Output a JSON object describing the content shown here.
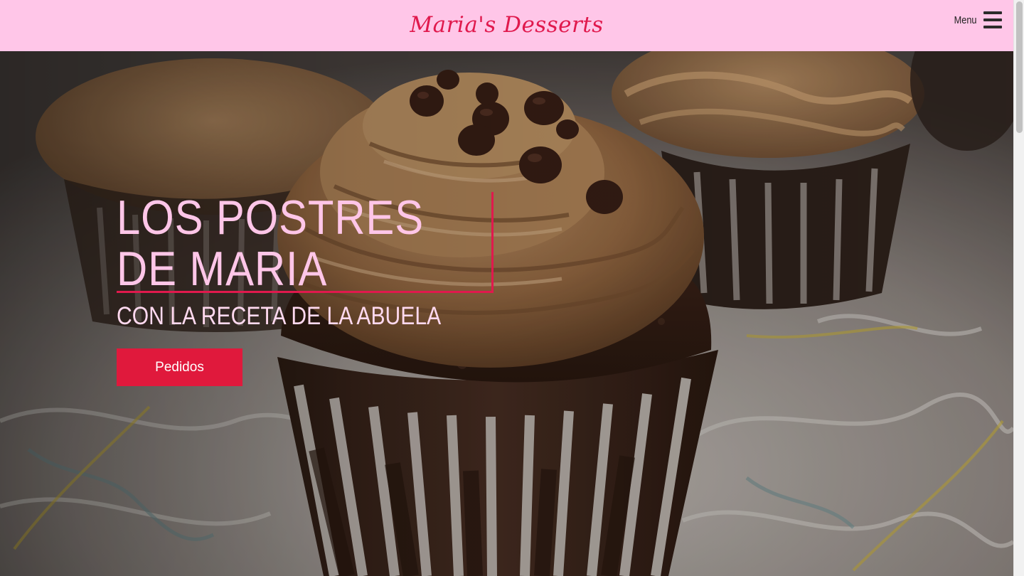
{
  "header": {
    "brand": "Maria's Desserts",
    "menu_label": "Menu"
  },
  "hero": {
    "title": "LOS POSTRES DE MARIA",
    "subtitle": "CON LA RECETA DE LA ABUELA",
    "cta_label": "Pedidos",
    "background_image": "chocolate-cupcake-photo"
  },
  "colors": {
    "header_bg": "#ffc6e8",
    "brand": "#e0194d",
    "hero_text": "#ffc6e8",
    "accent": "#e0193c"
  }
}
